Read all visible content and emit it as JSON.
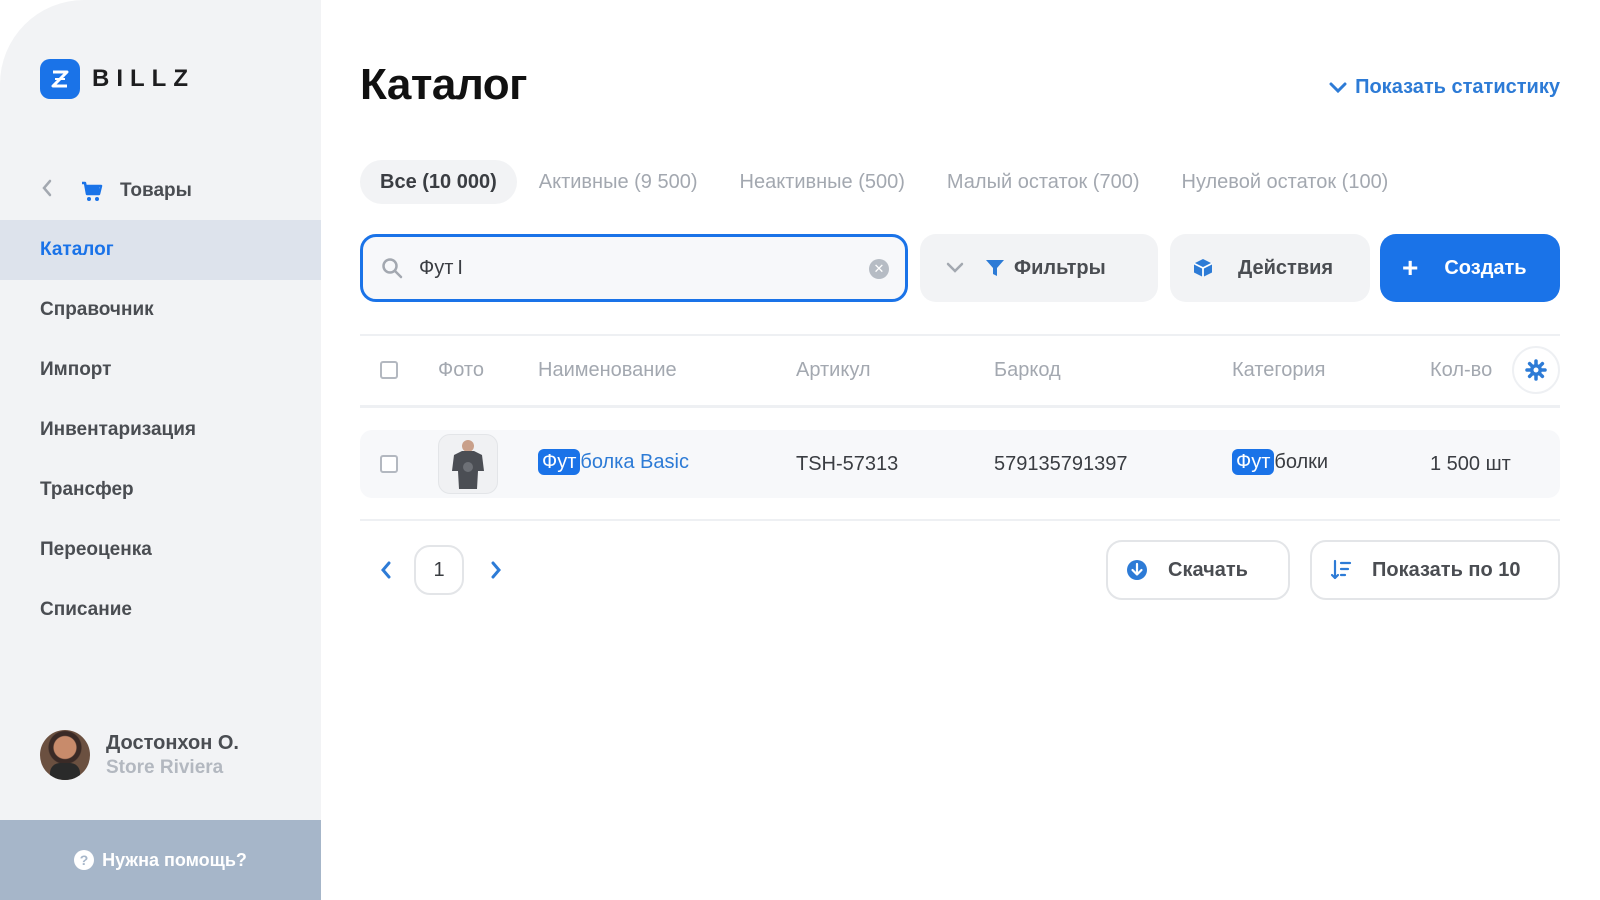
{
  "brand": {
    "name": "BILLZ",
    "mark": "Z"
  },
  "sidebar": {
    "back_label": "Товары",
    "items": [
      {
        "label": "Каталог",
        "active": true
      },
      {
        "label": "Справочник"
      },
      {
        "label": "Импорт"
      },
      {
        "label": "Инвентаризация"
      },
      {
        "label": "Трансфер"
      },
      {
        "label": "Переоценка"
      },
      {
        "label": "Списание"
      }
    ],
    "user": {
      "name": "Достонхон О.",
      "store": "Store Riviera"
    },
    "help_label": "Нужна помощь?",
    "help_icon": "?"
  },
  "header": {
    "title": "Каталог",
    "stats_link": "Показать статистику"
  },
  "tabs": [
    {
      "label": "Все (10 000)",
      "active": true
    },
    {
      "label": "Активные (9 500)"
    },
    {
      "label": "Неактивные (500)"
    },
    {
      "label": "Малый остаток (700)"
    },
    {
      "label": "Нулевой остаток (100)"
    }
  ],
  "search": {
    "value": "Фут",
    "cursor": "I"
  },
  "toolbar": {
    "filters": "Фильтры",
    "actions": "Действия",
    "create": "Создать",
    "create_icon": "+"
  },
  "table": {
    "columns": {
      "photo": "Фото",
      "name": "Наименование",
      "sku": "Артикул",
      "barcode": "Баркод",
      "category": "Категория",
      "qty": "Кол-во"
    },
    "rows": [
      {
        "name_match": "Фут",
        "name_rest": "болка Basic",
        "sku": "TSH-57313",
        "barcode": "579135791397",
        "category_match": "Фут",
        "category_rest": "болки",
        "qty": "1 500 шт"
      }
    ]
  },
  "pagination": {
    "page": "1"
  },
  "footer": {
    "download": "Скачать",
    "page_size": "Показать по 10"
  },
  "colors": {
    "accent": "#1a73e8",
    "link": "#2d7bd6",
    "help_bg": "#a6b6c9",
    "sidebar_bg": "#f2f3f5"
  }
}
